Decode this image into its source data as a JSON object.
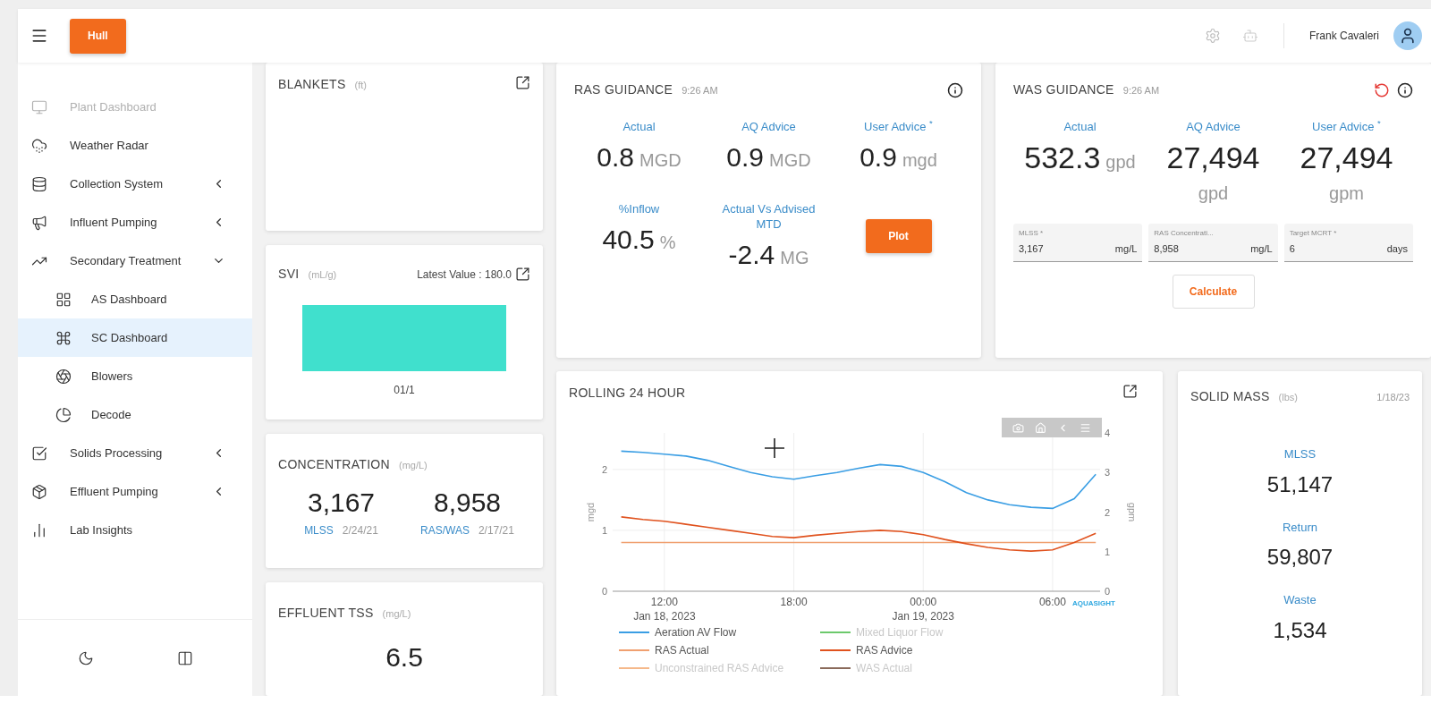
{
  "header": {
    "site_button": "Hull",
    "user_name": "Frank Cavaleri"
  },
  "sidebar": {
    "items": [
      {
        "label": "Plant Dashboard",
        "kind": "link",
        "disabled": true,
        "selected": false
      },
      {
        "label": "Weather Radar",
        "kind": "link",
        "disabled": false,
        "selected": false
      },
      {
        "label": "Collection System",
        "kind": "group",
        "expanded": false,
        "disabled": false,
        "selected": false
      },
      {
        "label": "Influent Pumping",
        "kind": "group",
        "expanded": false,
        "disabled": false,
        "selected": false
      },
      {
        "label": "Secondary Treatment",
        "kind": "group",
        "expanded": true,
        "disabled": false,
        "selected": false,
        "children": [
          {
            "label": "AS Dashboard",
            "disabled": false,
            "selected": false
          },
          {
            "label": "SC Dashboard",
            "disabled": false,
            "selected": true
          },
          {
            "label": "Blowers",
            "disabled": false,
            "selected": false
          },
          {
            "label": "Decode",
            "disabled": false,
            "selected": false
          }
        ]
      },
      {
        "label": "Solids Processing",
        "kind": "group",
        "expanded": false,
        "disabled": false,
        "selected": false
      },
      {
        "label": "Effluent Pumping",
        "kind": "group",
        "expanded": false,
        "disabled": false,
        "selected": false
      },
      {
        "label": "Lab Insights",
        "kind": "link",
        "disabled": false,
        "selected": false
      }
    ]
  },
  "blankets": {
    "title": "BLANKETS",
    "unit": "(ft)"
  },
  "svi": {
    "title": "SVI",
    "unit": "(mL/g)",
    "latest": "Latest Value : 180.0",
    "bar_label": "01/1"
  },
  "concentration": {
    "title": "CONCENTRATION",
    "unit": "(mg/L)",
    "items": [
      {
        "value": "3,167",
        "label": "MLSS",
        "date": "2/24/21"
      },
      {
        "value": "8,958",
        "label": "RAS/WAS",
        "date": "2/17/21"
      }
    ]
  },
  "effluent_tss": {
    "title": "EFFLUENT TSS",
    "unit": "(mg/L)",
    "value": "6.5"
  },
  "ras_guidance": {
    "title": "RAS GUIDANCE",
    "time": "9:26 AM",
    "metrics": [
      {
        "label": "Actual",
        "value": "0.8",
        "unit": "MGD"
      },
      {
        "label": "AQ Advice",
        "value": "0.9",
        "unit": "MGD"
      },
      {
        "label": "User Advice $^{*}$",
        "value": "0.9",
        "unit": "mgd"
      },
      {
        "label": "%Inflow",
        "value": "40.5",
        "unit": "%"
      },
      {
        "label": "Actual Vs Advised MTD",
        "value": "-2.4",
        "unit": "MG"
      }
    ],
    "button": "Plot"
  },
  "was_guidance": {
    "title": "WAS GUIDANCE",
    "time": "9:26 AM",
    "metrics": [
      {
        "label": "Actual",
        "value": "532.3",
        "unit": "gpd"
      },
      {
        "label": "AQ Advice",
        "value": "27,494",
        "unit": "gpd"
      },
      {
        "label": "User Advice $^{*}$",
        "value": "27,494",
        "unit": "gpm"
      }
    ],
    "fields": [
      {
        "label": "MLSS *",
        "value": "3,167",
        "unit": "mg/L"
      },
      {
        "label": "RAS Concentrati...",
        "value": "8,958",
        "unit": "mg/L"
      },
      {
        "label": "Target MCRT *",
        "value": "6",
        "unit": "days"
      }
    ],
    "button": "Calculate"
  },
  "rolling": {
    "title": "ROLLING 24 HOUR",
    "brand": "AQUASIGHT",
    "chart_data": {
      "type": "line",
      "grid": true,
      "legend": "bottom",
      "ylabel": "mgd",
      "y2label": "gpm",
      "ylim": [
        0,
        2.6
      ],
      "y2lim": [
        0,
        4
      ],
      "categories": [
        null,
        null,
        "12:00\nJan 18, 2023",
        null,
        null,
        null,
        null,
        null,
        "18:00",
        null,
        null,
        null,
        null,
        null,
        "00:00\nJan 19, 2023",
        null,
        null,
        null,
        null,
        null,
        "06:00",
        null,
        null
      ],
      "yticks": [
        0,
        1,
        2
      ],
      "y2ticks": [
        0,
        1,
        2,
        3,
        4
      ],
      "series": [
        {
          "name": "Aeration AV Flow",
          "color": "#3a9ee4",
          "values": [
            2.3,
            2.28,
            2.25,
            2.22,
            2.15,
            2.05,
            1.95,
            1.88,
            1.84,
            1.9,
            1.95,
            2.02,
            2.08,
            2.05,
            1.95,
            1.8,
            1.62,
            1.5,
            1.42,
            1.38,
            1.36,
            1.52,
            1.92
          ]
        },
        {
          "name": "Mixed Liquor Flow",
          "color": "#6cc96c",
          "values": [
            null,
            null,
            null,
            null,
            null,
            null,
            null,
            null,
            null,
            null,
            null,
            null,
            null,
            null,
            null,
            null,
            null,
            null,
            null,
            null,
            null,
            null,
            null
          ]
        },
        {
          "name": "RAS Actual",
          "color": "#f0a070",
          "values": [
            0.8,
            0.8,
            0.8,
            0.8,
            0.8,
            0.8,
            0.8,
            0.8,
            0.8,
            0.8,
            0.8,
            0.8,
            0.8,
            0.8,
            0.8,
            0.8,
            0.8,
            0.8,
            0.8,
            0.8,
            0.8,
            0.8,
            0.8
          ]
        },
        {
          "name": "RAS Advice",
          "color": "#e0521e",
          "values": [
            1.22,
            1.18,
            1.15,
            1.1,
            1.05,
            1.0,
            0.95,
            0.9,
            0.88,
            0.92,
            0.95,
            0.98,
            1.0,
            0.98,
            0.93,
            0.85,
            0.78,
            0.72,
            0.68,
            0.66,
            0.68,
            0.8,
            0.95
          ]
        },
        {
          "name": "Unconstrained RAS Advice",
          "color": "#f5b88a",
          "values": [
            null,
            null,
            null,
            null,
            null,
            null,
            null,
            null,
            null,
            null,
            null,
            null,
            null,
            null,
            null,
            null,
            null,
            null,
            null,
            null,
            null,
            null,
            null
          ]
        },
        {
          "name": "WAS Actual",
          "color": "#8a6a5a",
          "values": [
            null,
            null,
            null,
            null,
            null,
            null,
            null,
            null,
            null,
            null,
            null,
            null,
            null,
            null,
            null,
            null,
            null,
            null,
            null,
            null,
            null,
            null,
            null
          ]
        }
      ]
    }
  },
  "solid_mass": {
    "title": "SOLID MASS",
    "unit": "(lbs)",
    "date": "1/18/23",
    "items": [
      {
        "label": "MLSS",
        "value": "51,147"
      },
      {
        "label": "Return",
        "value": "59,807"
      },
      {
        "label": "Waste",
        "value": "1,534"
      }
    ]
  }
}
